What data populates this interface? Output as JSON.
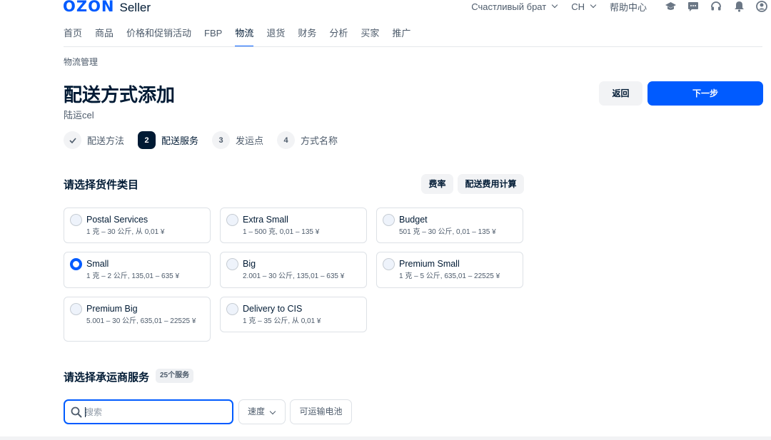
{
  "header": {
    "logo_brand": "OZON",
    "logo_product": "Seller",
    "account_name": "Счастливый брат",
    "language": "CH",
    "help_center": "帮助中心",
    "icons": [
      "graduation-cap-icon",
      "chat-icon",
      "headset-icon",
      "bell-icon",
      "user-icon"
    ]
  },
  "nav": {
    "items": [
      "首页",
      "商品",
      "价格和促销活动",
      "FBP",
      "物流",
      "退货",
      "财务",
      "分析",
      "买家",
      "推广"
    ],
    "active": "物流"
  },
  "breadcrumb": "物流管理",
  "page": {
    "title": "配送方式添加",
    "subtitle": "陆运cel",
    "back_label": "返回",
    "next_label": "下一步"
  },
  "stepper": {
    "steps": [
      {
        "number": "",
        "label": "配送方法",
        "state": "done"
      },
      {
        "number": "2",
        "label": "配送服务",
        "state": "active"
      },
      {
        "number": "3",
        "label": "发运点",
        "state": "pending"
      },
      {
        "number": "4",
        "label": "方式名称",
        "state": "pending"
      }
    ]
  },
  "category_section": {
    "title": "请选择货件类目",
    "rates_label": "费率",
    "calc_label": "配送费用计算",
    "cards": [
      {
        "title": "Postal Services",
        "desc": "1 克 – 30 公斤, 从 0,01 ¥",
        "checked": false
      },
      {
        "title": "Extra Small",
        "desc": "1 – 500 克, 0,01 – 135 ¥",
        "checked": false
      },
      {
        "title": "Budget",
        "desc": "501 克 – 30 公斤, 0,01 – 135 ¥",
        "checked": false
      },
      {
        "title": "Small",
        "desc": "1 克 – 2 公斤, 135,01 – 635 ¥",
        "checked": true
      },
      {
        "title": "Big",
        "desc": "2.001 – 30 公斤, 135,01 – 635 ¥",
        "checked": false
      },
      {
        "title": "Premium Small",
        "desc": "1 克 – 5 公斤, 635,01 – 22525 ¥",
        "checked": false
      },
      {
        "title": "Premium Big",
        "desc": "5.001 – 30 公斤, 635,01 – 22525 ¥",
        "checked": false
      },
      {
        "title": "Delivery to CIS",
        "desc": "1 克 – 35 公斤, 从 0,01 ¥",
        "checked": false
      }
    ]
  },
  "carrier_section": {
    "title": "请选择承运商服务",
    "count_badge": "25个服务",
    "search_placeholder": "搜索",
    "search_value": "",
    "speed_select": "速度",
    "battery_filter": "可运输电池"
  },
  "colors": {
    "accent": "#005bff",
    "text": "#001a34",
    "muted": "#4d5b6b",
    "button_bg": "#f2f3f5"
  }
}
